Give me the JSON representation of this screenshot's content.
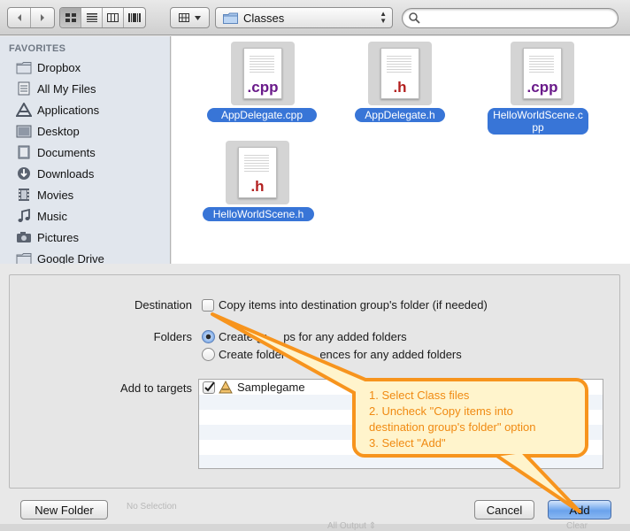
{
  "toolbar": {
    "back_icon": "chevron-left",
    "forward_icon": "chevron-right",
    "view_modes": [
      "icon-view",
      "list-view",
      "column-view",
      "coverflow-view"
    ],
    "arrange_icon": "grid-arrange",
    "path_popup": "Classes",
    "search_placeholder": ""
  },
  "sidebar": {
    "header": "FAVORITES",
    "items": [
      {
        "label": "Dropbox",
        "icon": "dropbox-folder"
      },
      {
        "label": "All My Files",
        "icon": "all-files"
      },
      {
        "label": "Applications",
        "icon": "applications"
      },
      {
        "label": "Desktop",
        "icon": "desktop"
      },
      {
        "label": "Documents",
        "icon": "documents"
      },
      {
        "label": "Downloads",
        "icon": "downloads"
      },
      {
        "label": "Movies",
        "icon": "movies"
      },
      {
        "label": "Music",
        "icon": "music"
      },
      {
        "label": "Pictures",
        "icon": "pictures"
      },
      {
        "label": "Google Drive",
        "icon": "folder"
      }
    ]
  },
  "files": [
    {
      "ext": ".cpp",
      "name": "AppDelegate.cpp",
      "ext_color": "#6a1b8a"
    },
    {
      "ext": ".h",
      "name": "AppDelegate.h",
      "ext_color": "#b3201f"
    },
    {
      "ext": ".cpp",
      "name_line1": "HelloWorldScene.c",
      "name_line2": "pp",
      "ext_color": "#6a1b8a"
    },
    {
      "ext": ".h",
      "name": "HelloWorldScene.h",
      "ext_color": "#b3201f"
    }
  ],
  "options": {
    "destination_label": "Destination",
    "copy_items": "Copy items into destination group's folder (if needed)",
    "copy_checked": false,
    "folders_label": "Folders",
    "create_groups_a": "Create gr",
    "create_groups_b": "ps for any added folders",
    "create_refs_a": "Create folder re",
    "create_refs_b": "ences for any added folders",
    "targets_label": "Add to targets",
    "target": "Samplegame",
    "target_checked": true
  },
  "callout": {
    "line1": "1. Select Class files",
    "line2": "2. Uncheck \"Copy items into",
    "line3": "destination group's folder\" option",
    "line4": "3. Select \"Add\"",
    "color": "#f7941d"
  },
  "buttons": {
    "new_folder": "New Folder",
    "cancel": "Cancel",
    "add": "Add"
  },
  "background_text": {
    "no_selection": "No Selection",
    "all_output": "All Output ⇕",
    "clear": "Clear"
  }
}
